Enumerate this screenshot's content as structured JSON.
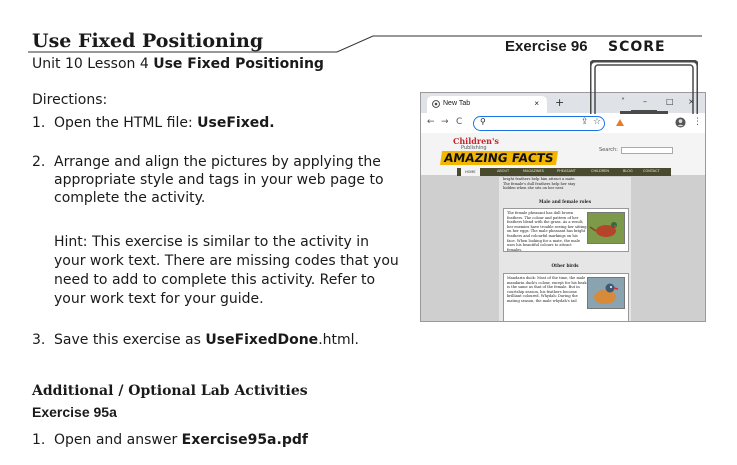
{
  "header": {
    "title": "Use Fixed Positioning",
    "exercise": "Exercise 96",
    "score_label": "SCORE",
    "subtitle_prefix": "Unit 10 Lesson 4",
    "subtitle_bold": "Use Fixed Positioning"
  },
  "directions": {
    "heading": "Directions:",
    "steps": [
      {
        "num": "1.",
        "text": "Open the HTML file: ",
        "bold": "UseFixed."
      },
      {
        "num": "2.",
        "text": "Arrange and align the pictures by applying the appropriate style and tags in your web page to complete the activity."
      },
      {
        "num": "3.",
        "text": "Save this exercise as ",
        "bold": "UseFixedDone",
        "suffix": ".html."
      }
    ],
    "hint": "Hint: This exercise is similar to the activity in your work text. There are missing codes that you need to add to complete this activity.  Refer to your work text for your guide."
  },
  "additional": {
    "heading": "Additional / Optional Lab Activities",
    "exercise": "Exercise 95a",
    "step_num": "1.",
    "step_text": "Open and answer ",
    "step_bold": "Exercise95a.pdf"
  },
  "browser": {
    "tab_label": "New Tab",
    "tab_close": "×",
    "new_tab": "+",
    "controls": [
      "˅",
      "–",
      "□",
      "×"
    ],
    "site_logo_top": "Children's",
    "site_logo_pub": "Publishing",
    "site_logo_main": "AMAZING FACTS",
    "search_label": "Search:",
    "nav_items": [
      "HOME",
      "ABOUT",
      "MAGAZINES",
      "PHEASANT",
      "CHILDREN",
      "BLOG",
      "CONTACT"
    ],
    "top_snippet": "bright feathers help him attract a mate. The female's dull feathers help her stay hidden when she sits on her nest.",
    "section1": "Male and female roles",
    "box1_text": "The female pheasant has dull brown feathers. The colour and pattern of her feathers blend with the grass. As a result, her enemies have trouble seeing her sitting on her eggs. The male pheasant has bright feathers and colourful markings on his face. When looking for a mate, the male uses his beautiful colours to attract females.",
    "section2": "Other birds",
    "box2_text": "Mandarin duck: Most of the time, the male mandarin duck's colour, except for his beak is the same as that of the female. But in courtship season, his feathers become brilliant coloured. Whydah: During the mating season, the male whydah's tail"
  },
  "colors": {
    "accent_blue": "#1a73e8",
    "logo_red": "#c2272d",
    "logo_yellow": "#f3b600",
    "nav_olive": "#4a4a2e"
  }
}
